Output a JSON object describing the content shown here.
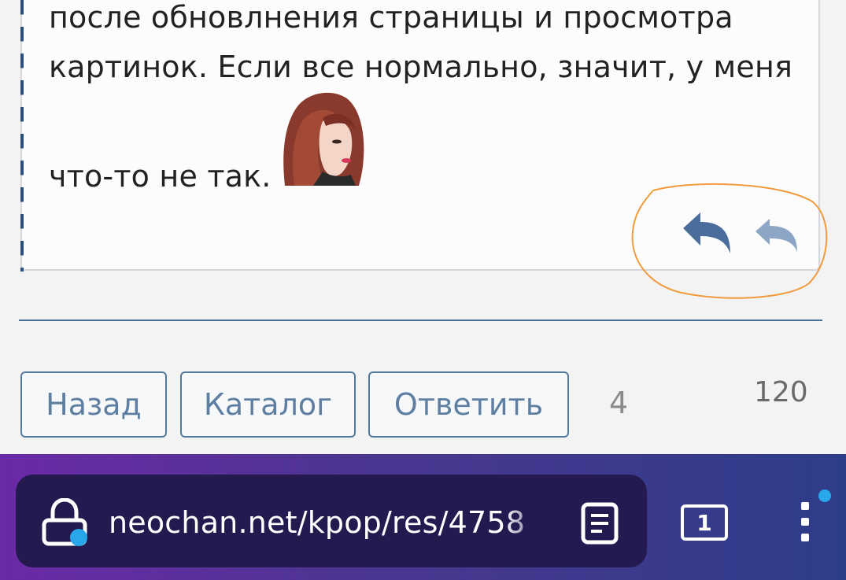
{
  "post": {
    "lines": [
      "после обновлнения страницы и просмотра",
      "картинок. Если все нормально, значит, у меня",
      "что-то не так."
    ]
  },
  "actions": {
    "reply_icon_a": "reply-arrow-icon",
    "reply_icon_b": "reply-arrow-icon"
  },
  "nav": {
    "back_label": "Назад",
    "catalog_label": "Каталог",
    "reply_label": "Ответить",
    "count_a": "4",
    "count_b": "120"
  },
  "browser": {
    "url": "neochan.net/kpop/res/4758",
    "tab_count": "1",
    "icons": [
      "lock-icon",
      "reader-mode-icon",
      "tabs-icon",
      "menu-icon"
    ]
  },
  "colors": {
    "accent": "#557a9f",
    "browser_bar": "#4a3690",
    "highlight": "#f29a3c"
  }
}
